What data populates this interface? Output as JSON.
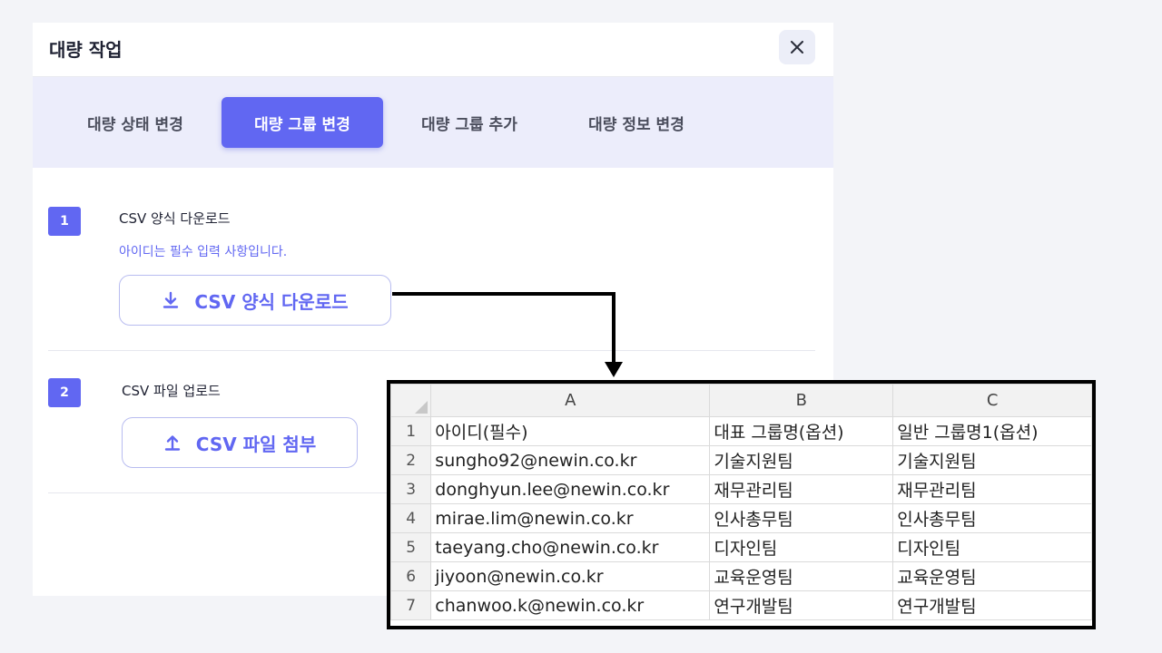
{
  "modal": {
    "title": "대량 작업",
    "close_icon": "close-icon"
  },
  "tabs": [
    {
      "label": "대량 상태 변경",
      "active": false
    },
    {
      "label": "대량 그룹 변경",
      "active": true
    },
    {
      "label": "대량 그룹 추가",
      "active": false
    },
    {
      "label": "대량 정보 변경",
      "active": false
    }
  ],
  "step1": {
    "number": "1",
    "title": "CSV 양식 다운로드",
    "hint": "아이디는 필수 입력 사항입니다.",
    "button_label": "CSV 양식 다운로드",
    "button_icon": "download-icon"
  },
  "step2": {
    "number": "2",
    "title": "CSV 파일 업로드",
    "button_label": "CSV 파일 첨부",
    "button_icon": "upload-icon"
  },
  "spreadsheet": {
    "columns": [
      "A",
      "B",
      "C"
    ],
    "rows": [
      {
        "num": "1",
        "cells": [
          "아이디(필수)",
          "대표 그룹명(옵션)",
          "일반 그룹명1(옵션)"
        ]
      },
      {
        "num": "2",
        "cells": [
          "sungho92@newin.co.kr",
          "기술지원팀",
          "기술지원팀"
        ]
      },
      {
        "num": "3",
        "cells": [
          "donghyun.lee@newin.co.kr",
          "재무관리팀",
          "재무관리팀"
        ]
      },
      {
        "num": "4",
        "cells": [
          "mirae.lim@newin.co.kr",
          "인사총무팀",
          "인사총무팀"
        ]
      },
      {
        "num": "5",
        "cells": [
          "taeyang.cho@newin.co.kr",
          "디자인팀",
          "디자인팀"
        ]
      },
      {
        "num": "6",
        "cells": [
          "jiyoon@newin.co.kr",
          "교육운영팀",
          "교육운영팀"
        ]
      },
      {
        "num": "7",
        "cells": [
          "chanwoo.k@newin.co.kr",
          "연구개발팀",
          "연구개발팀"
        ]
      }
    ]
  },
  "colors": {
    "accent": "#6167f2",
    "tab_bar_bg": "#ecedfb",
    "page_bg": "#f3f4f8"
  }
}
